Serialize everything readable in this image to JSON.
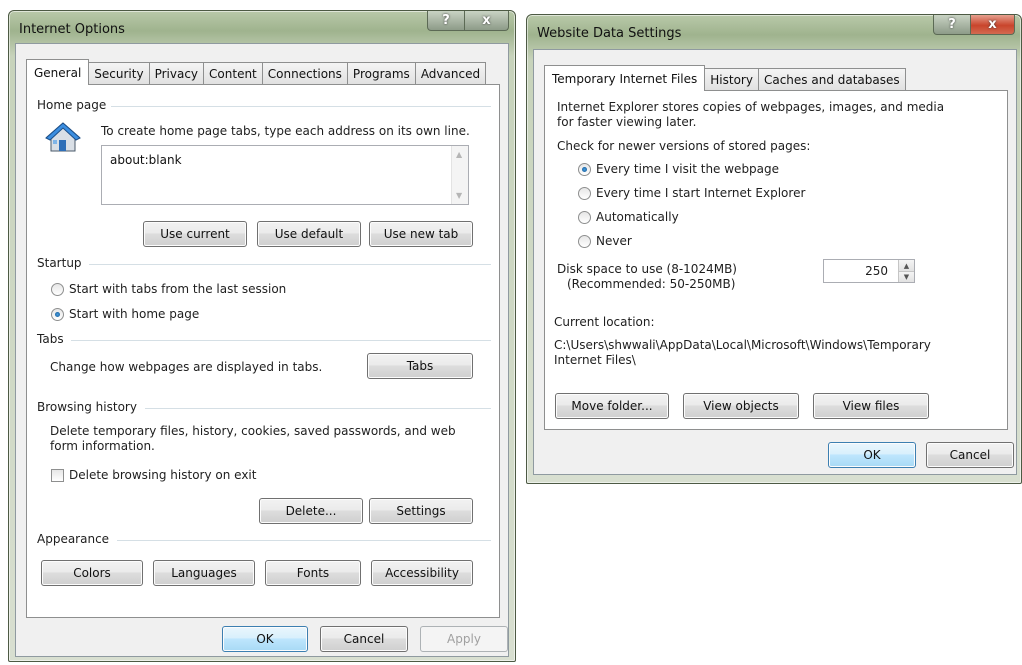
{
  "internet_options": {
    "title": "Internet Options",
    "help_glyph": "?",
    "close_glyph": "x",
    "tabs": [
      "General",
      "Security",
      "Privacy",
      "Content",
      "Connections",
      "Programs",
      "Advanced"
    ],
    "home_page": {
      "heading": "Home page",
      "instruction": "To create home page tabs, type each address on its own line.",
      "value": "about:blank",
      "use_current": "Use current",
      "use_default": "Use default",
      "use_new_tab": "Use new tab"
    },
    "startup": {
      "heading": "Startup",
      "option_last_session": "Start with tabs from the last session",
      "option_home_page": "Start with home page",
      "selected": "Start with home page"
    },
    "tabs_section": {
      "heading": "Tabs",
      "description": "Change how webpages are displayed in tabs.",
      "button": "Tabs"
    },
    "browsing_history": {
      "heading": "Browsing history",
      "description_line1": "Delete temporary files, history, cookies, saved passwords, and web",
      "description_line2": "form information.",
      "delete_on_exit": "Delete browsing history on exit",
      "delete_on_exit_checked": false,
      "delete_button": "Delete...",
      "settings_button": "Settings"
    },
    "appearance": {
      "heading": "Appearance",
      "colors": "Colors",
      "languages": "Languages",
      "fonts": "Fonts",
      "accessibility": "Accessibility"
    },
    "footer": {
      "ok": "OK",
      "cancel": "Cancel",
      "apply": "Apply"
    }
  },
  "website_data": {
    "title": "Website Data Settings",
    "help_glyph": "?",
    "close_glyph": "x",
    "tabs": [
      "Temporary Internet Files",
      "History",
      "Caches and databases"
    ],
    "intro_line1": "Internet Explorer stores copies of webpages, images, and media",
    "intro_line2": "for faster viewing later.",
    "check_heading": "Check for newer versions of stored pages:",
    "options": {
      "every_visit": "Every time I visit the webpage",
      "every_start": "Every time I start Internet Explorer",
      "automatically": "Automatically",
      "never": "Never"
    },
    "selected_option": "Every time I visit the webpage",
    "disk_label_line1": "Disk space to use (8-1024MB)",
    "disk_label_line2": "(Recommended: 50-250MB)",
    "disk_value": "250",
    "location_heading": "Current location:",
    "location_line1": "C:\\Users\\shwwali\\AppData\\Local\\Microsoft\\Windows\\Temporary",
    "location_line2": "Internet Files\\",
    "move_folder": "Move folder...",
    "view_objects": "View objects",
    "view_files": "View files",
    "ok": "OK",
    "cancel": "Cancel"
  },
  "colors": {
    "glass": "#9fb38e",
    "tab_border": "#8e8f8f",
    "default_button": "#3c7fb1",
    "close_red": "#c9452c"
  }
}
